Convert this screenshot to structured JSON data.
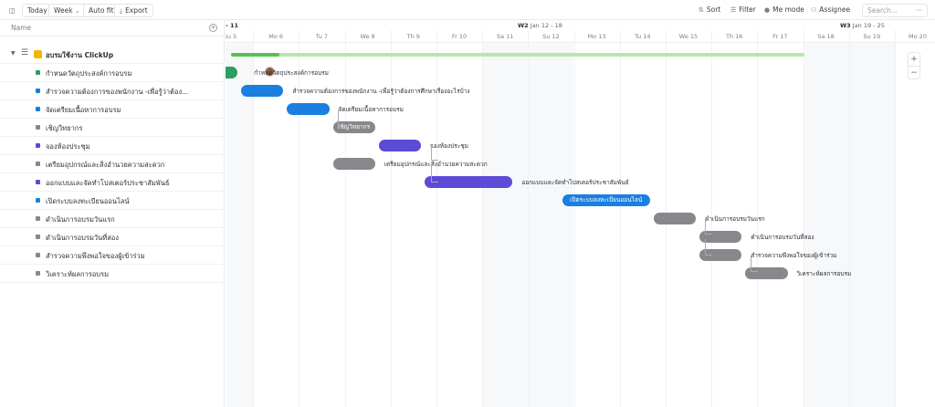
{
  "toolbar": {
    "today": "Today",
    "week": "Week",
    "autofit": "Auto fit",
    "export": "Export",
    "sort": "Sort",
    "filter": "Filter",
    "me_mode": "Me mode",
    "assignee": "Assignee",
    "search_placeholder": "Search..."
  },
  "left": {
    "name_header": "Name",
    "group_name": "อบรมใช้งาน ClickUp",
    "tasks": [
      {
        "label": "กำหนดวัตถุประสงค์การอบรม",
        "color": "#2e9e5e"
      },
      {
        "label": "สำรวจความต้องการของพนักงาน -เพื่อรู้ว่าต้อง...",
        "color": "#1a7fe0"
      },
      {
        "label": "จัดเตรียมเนื้อหาการอบรม",
        "color": "#1a7fe0"
      },
      {
        "label": "เชิญวิทยากร",
        "color": "#87888b"
      },
      {
        "label": "จองห้องประชุม",
        "color": "#5b4bd6"
      },
      {
        "label": "เตรียมอุปกรณ์และสิ่งอำนวยความสะดวก",
        "color": "#87888b"
      },
      {
        "label": "ออกแบบและจัดทำโปสเตอร์ประชาสัมพันธ์",
        "color": "#5b4bd6"
      },
      {
        "label": "เปิดระบบลงทะเบียนออนไลน์",
        "color": "#1a7fe0"
      },
      {
        "label": "ดำเนินการอบรมวันแรก",
        "color": "#87888b"
      },
      {
        "label": "ดำเนินการอบรมวันที่สอง",
        "color": "#87888b"
      },
      {
        "label": "สำรวจความพึงพอใจของผู้เข้าร่วม",
        "color": "#87888b"
      },
      {
        "label": "วิเคราะห์ผลการอบรม",
        "color": "#87888b"
      }
    ]
  },
  "timeline": {
    "weeks": [
      {
        "num": "- 11",
        "range": ""
      },
      {
        "num": "W2",
        "range": "Jan 12 - 18"
      },
      {
        "num": "W3",
        "range": "Jan 19 - 25"
      }
    ],
    "days": [
      "Su 5",
      "Mo 6",
      "Tu 7",
      "We 8",
      "Th 9",
      "Fr 10",
      "Sa 11",
      "Su 12",
      "Mo 13",
      "Tu 14",
      "We 15",
      "Th 16",
      "Fr 17",
      "Sa 18",
      "Su 19",
      "Mo 20"
    ],
    "bars": [
      {
        "start": 0.15,
        "dur": 0.45,
        "text": "",
        "label": "กำหนดวัตถุประสงค์การอบรม",
        "color": "#2e9e5e"
      },
      {
        "start": 0.6,
        "dur": 1.0,
        "text": "",
        "label": "สำรวจความต้องการของพนักงาน -เพื่อรู้ว่าต้องการศึกษาเรื่องอะไรบ้าง",
        "color": "#1a7fe0"
      },
      {
        "start": 1.6,
        "dur": 1.0,
        "text": "",
        "label": "จัดเตรียมเนื้อหาการอบรม",
        "color": "#1a7fe0"
      },
      {
        "start": 2.6,
        "dur": 1.0,
        "text": "เชิญวิทยากร",
        "label": "",
        "color": "#87888b"
      },
      {
        "start": 3.6,
        "dur": 1.0,
        "text": "",
        "label": "จองห้องประชุม",
        "color": "#5b4bd6"
      },
      {
        "start": 2.6,
        "dur": 1.0,
        "text": "",
        "label": "เตรียมอุปกรณ์และสิ่งอำนวยความสะดวก",
        "color": "#87888b"
      },
      {
        "start": 4.6,
        "dur": 2.0,
        "text": "",
        "label": "ออกแบบและจัดทำโปสเตอร์ประชาสัมพันธ์",
        "color": "#5b4bd6"
      },
      {
        "start": 7.6,
        "dur": 2.0,
        "text": "เปิดระบบลงทะเบียนออนไลน์",
        "label": "",
        "color": "#1a7fe0"
      },
      {
        "start": 9.6,
        "dur": 1.0,
        "text": "",
        "label": "ดำเนินการอบรมวันแรก",
        "color": "#87888b"
      },
      {
        "start": 10.6,
        "dur": 1.0,
        "text": "",
        "label": "ดำเนินการอบรมวันที่สอง",
        "color": "#87888b"
      },
      {
        "start": 10.6,
        "dur": 1.0,
        "text": "",
        "label": "สำรวจความพึงพอใจของผู้เข้าร่วม",
        "color": "#87888b"
      },
      {
        "start": 11.6,
        "dur": 1.0,
        "text": "",
        "label": "วิเคราะห์ผลการอบรม",
        "color": "#87888b"
      }
    ]
  },
  "zoom": {
    "in": "+",
    "out": "−"
  }
}
